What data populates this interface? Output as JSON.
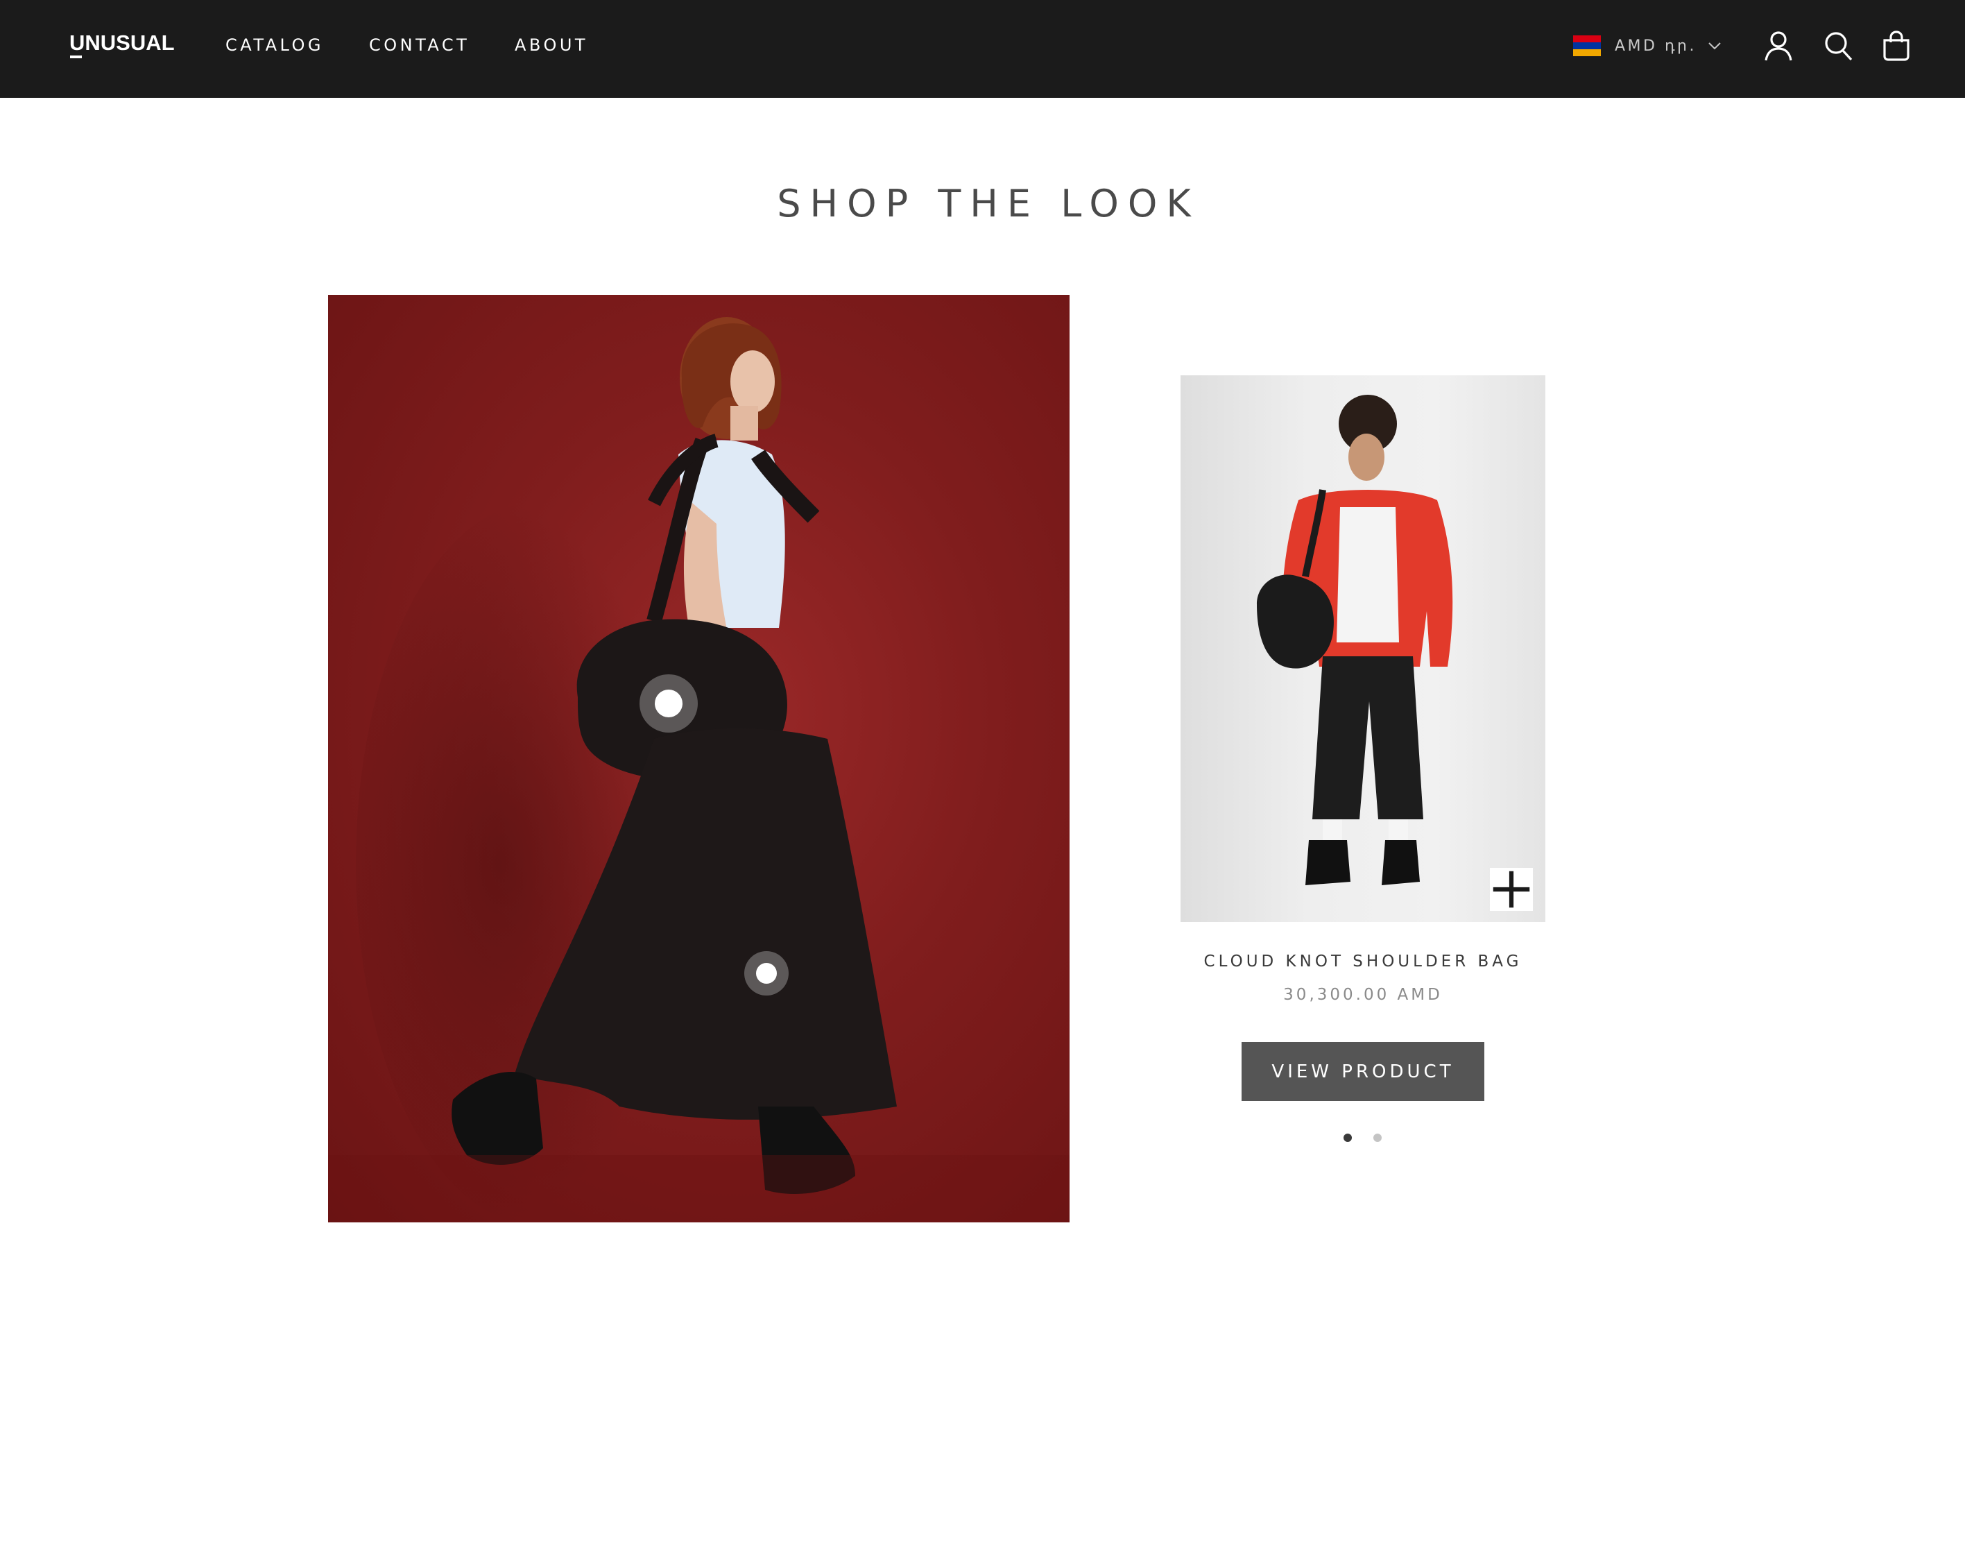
{
  "header": {
    "logo": "UNUSUAL",
    "nav": [
      {
        "label": "CATALOG"
      },
      {
        "label": "CONTACT"
      },
      {
        "label": "ABOUT"
      }
    ],
    "currency": {
      "label": "AMD դր.",
      "flag_colors": [
        "#d90012",
        "#0033a0",
        "#f2a800"
      ]
    },
    "icons": [
      "account-icon",
      "search-icon",
      "cart-icon"
    ]
  },
  "main": {
    "title": "SHOP THE LOOK",
    "look_image": {
      "hotspot_count": 2
    },
    "product": {
      "name": "CLOUD KNOT SHOULDER BAG",
      "price": "30,300.00 AMD",
      "button_label": "VIEW PRODUCT",
      "quick_add_icon": "plus-icon"
    },
    "pagination": {
      "count": 2,
      "active": 1
    }
  },
  "colors": {
    "header_bg": "#1b1b1b",
    "button_bg": "#555555",
    "look_bg": "#801d1d"
  }
}
